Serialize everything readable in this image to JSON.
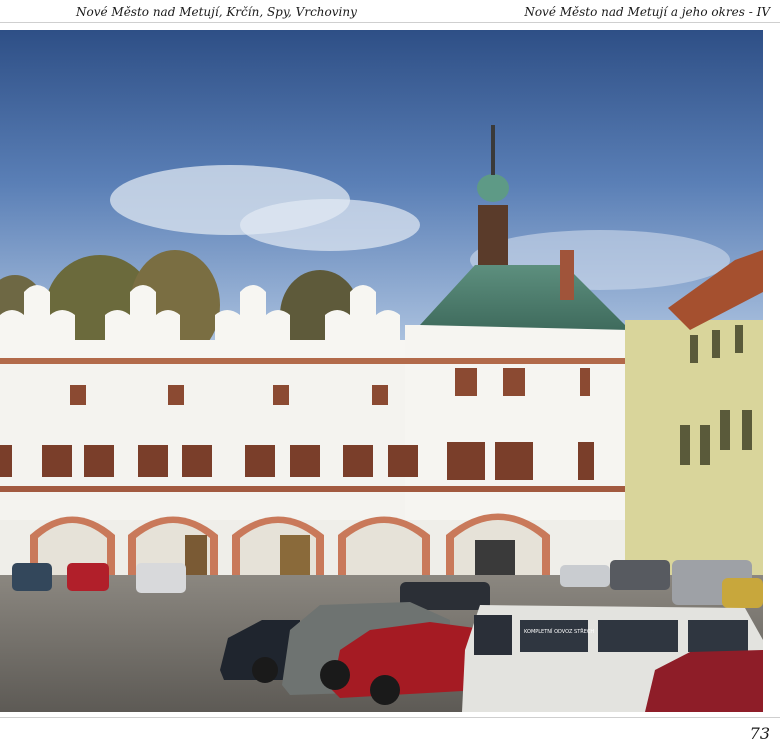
{
  "header": {
    "left_text": "Nové Město nad Metují, Krčín, Spy, Vrchoviny",
    "right_text": "Nové Město nad Metují a jeho okres - IV"
  },
  "photo": {
    "van_sign": "KOMPLETNÍ ODVOZ STŘECH"
  },
  "footer": {
    "page_number": "73"
  }
}
